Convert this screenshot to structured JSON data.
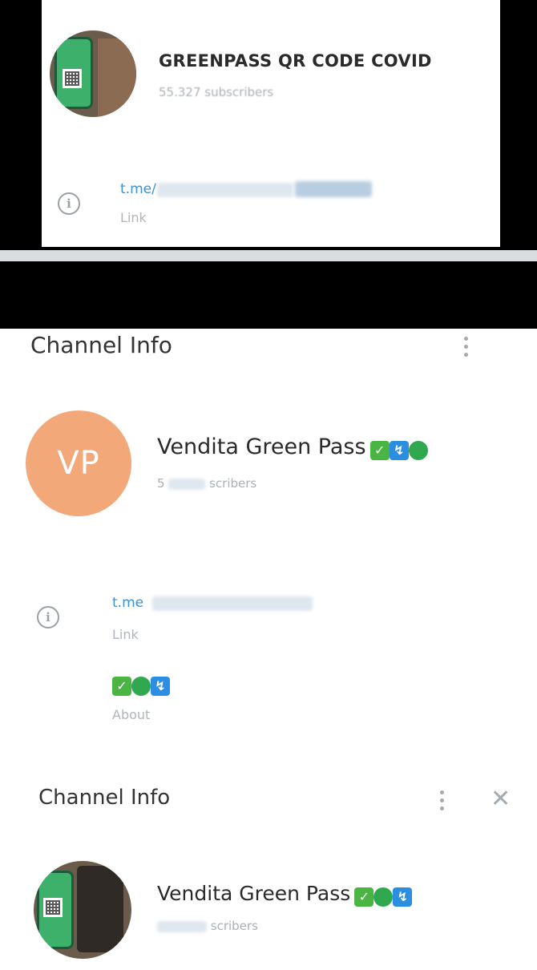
{
  "panel1": {
    "channel_title": "GREENPASS QR CODE COVID",
    "subscribers": "55.327 subscribers",
    "link_prefix": "t.me/",
    "link_label": "Link"
  },
  "panel2": {
    "header_title": "Channel Info",
    "avatar_initials": "VP",
    "channel_name": "Vendita Green Pass",
    "subscribers_visible": "scribers",
    "subscribers_prefix": "5",
    "link_prefix": "t.me",
    "link_label": "Link",
    "about_label": "About",
    "about_emojis": [
      "check-box-emoji",
      "green-circle-emoji",
      "blue-box-emoji"
    ],
    "name_emojis": [
      "check-box-emoji",
      "blue-box-emoji",
      "green-circle-emoji"
    ]
  },
  "panel3": {
    "header_title": "Channel Info",
    "channel_name": "Vendita Green Pass",
    "subscribers_visible": "scribers",
    "name_emojis": [
      "check-box-emoji",
      "green-circle-emoji",
      "blue-box-emoji"
    ]
  },
  "colors": {
    "link": "#3b8fd4",
    "muted": "#a9b0b6",
    "avatar_orange": "#f3a87a",
    "emoji_green": "#4bb543",
    "emoji_blue": "#2b8ee0"
  }
}
